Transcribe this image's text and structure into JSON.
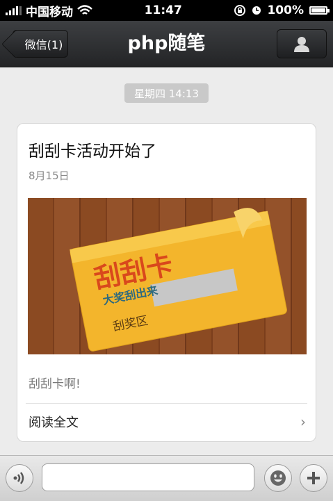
{
  "status_bar": {
    "carrier": "中国移动",
    "time": "11:47",
    "battery": "100%"
  },
  "navbar": {
    "back_label": "微信(1)",
    "title": "php随笔"
  },
  "timestamp": "星期四 14:13",
  "article": {
    "title": "刮刮卡活动开始了",
    "date": "8月15日",
    "cover": {
      "card_title": "刮刮卡",
      "card_subtitle": "大奖刮出来",
      "scratch_label": "刮奖区"
    },
    "summary": "刮刮卡啊!",
    "read_more": "阅读全文"
  },
  "colors": {
    "nav_bg": "#2c2d30",
    "card_yellow": "#f6b62f",
    "card_red": "#d9481c"
  },
  "icons": [
    "signal-icon",
    "wifi-icon",
    "rotation-lock-icon",
    "alarm-icon",
    "battery-icon",
    "profile-icon",
    "voice-icon",
    "emoji-icon",
    "plus-icon",
    "chevron-right-icon"
  ]
}
